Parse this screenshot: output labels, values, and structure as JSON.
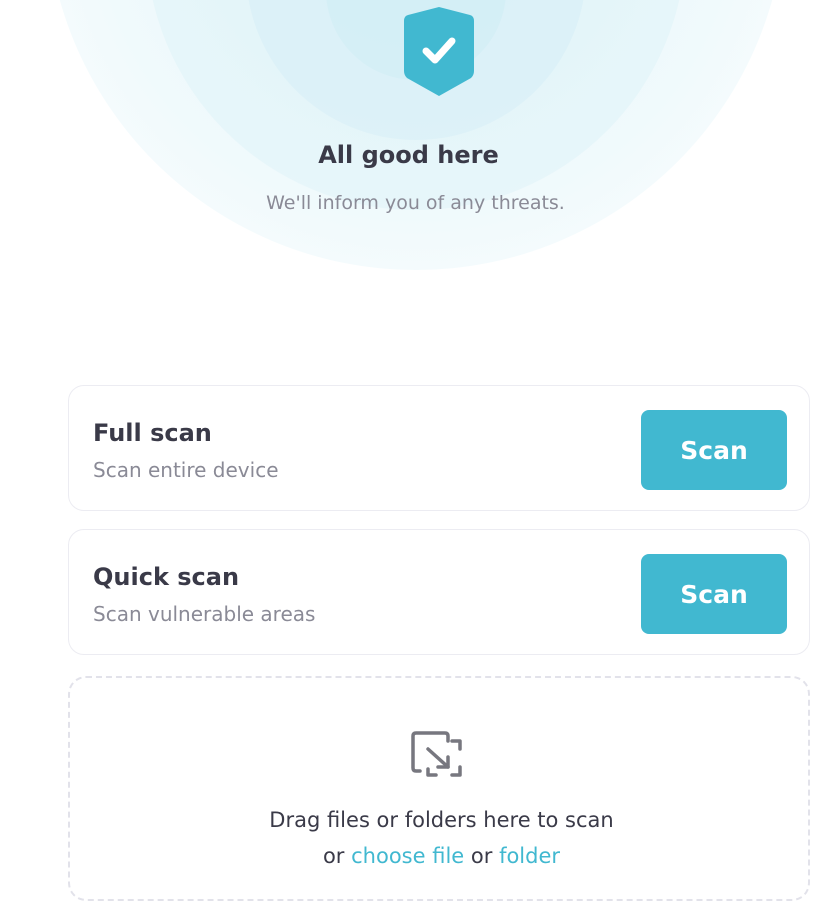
{
  "status": {
    "icon": "shield-check-icon",
    "title": "All good here",
    "subtitle": "We'll inform you of any threats."
  },
  "scans": [
    {
      "title": "Full scan",
      "subtitle": "Scan entire device",
      "button_label": "Scan"
    },
    {
      "title": "Quick scan",
      "subtitle": "Scan vulnerable areas",
      "button_label": "Scan"
    }
  ],
  "dropzone": {
    "icon": "drag-drop-icon",
    "text": "Drag files or folders here to scan",
    "or_1": "or",
    "choose_file_label": "choose file",
    "or_2": "or",
    "folder_label": "folder"
  },
  "colors": {
    "accent": "#41b8d0",
    "text_primary": "#3a3a48",
    "text_secondary": "#8a8a96",
    "border": "#ececf2"
  }
}
